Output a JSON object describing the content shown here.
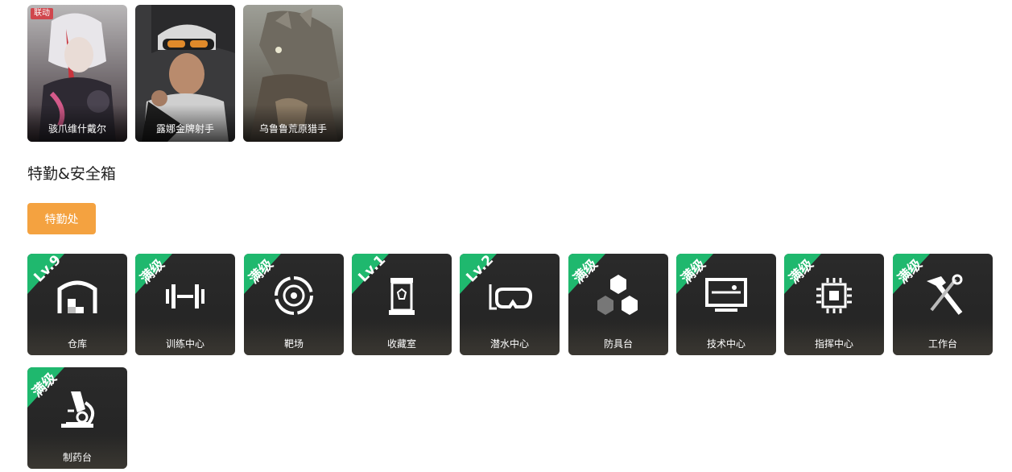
{
  "skins": [
    {
      "name": "骇爪维什戴尔",
      "tag": "联动"
    },
    {
      "name": "露娜金牌射手",
      "tag": ""
    },
    {
      "name": "乌鲁鲁荒原猎手",
      "tag": ""
    }
  ],
  "section": {
    "title": "特勤&安全箱",
    "tab_label": "特勤处"
  },
  "facilities": [
    {
      "name": "仓库",
      "level": "Lv.9",
      "icon": "warehouse-icon"
    },
    {
      "name": "训练中心",
      "level": "满级",
      "icon": "dumbbell-icon"
    },
    {
      "name": "靶场",
      "level": "满级",
      "icon": "target-icon"
    },
    {
      "name": "收藏室",
      "level": "Lv.1",
      "icon": "display-case-icon"
    },
    {
      "name": "潜水中心",
      "level": "Lv.2",
      "icon": "diving-mask-icon"
    },
    {
      "name": "防具台",
      "level": "满级",
      "icon": "armor-blocks-icon"
    },
    {
      "name": "技术中心",
      "level": "满级",
      "icon": "monitor-icon"
    },
    {
      "name": "指挥中心",
      "level": "满级",
      "icon": "chip-icon"
    },
    {
      "name": "工作台",
      "level": "满级",
      "icon": "hammer-wrench-icon"
    },
    {
      "name": "制药台",
      "level": "满级",
      "icon": "microscope-icon"
    }
  ],
  "colors": {
    "accent": "#f4a240",
    "ribbon": "#1fb86e",
    "tile_bg": "#262626",
    "tag": "#d0464d"
  }
}
